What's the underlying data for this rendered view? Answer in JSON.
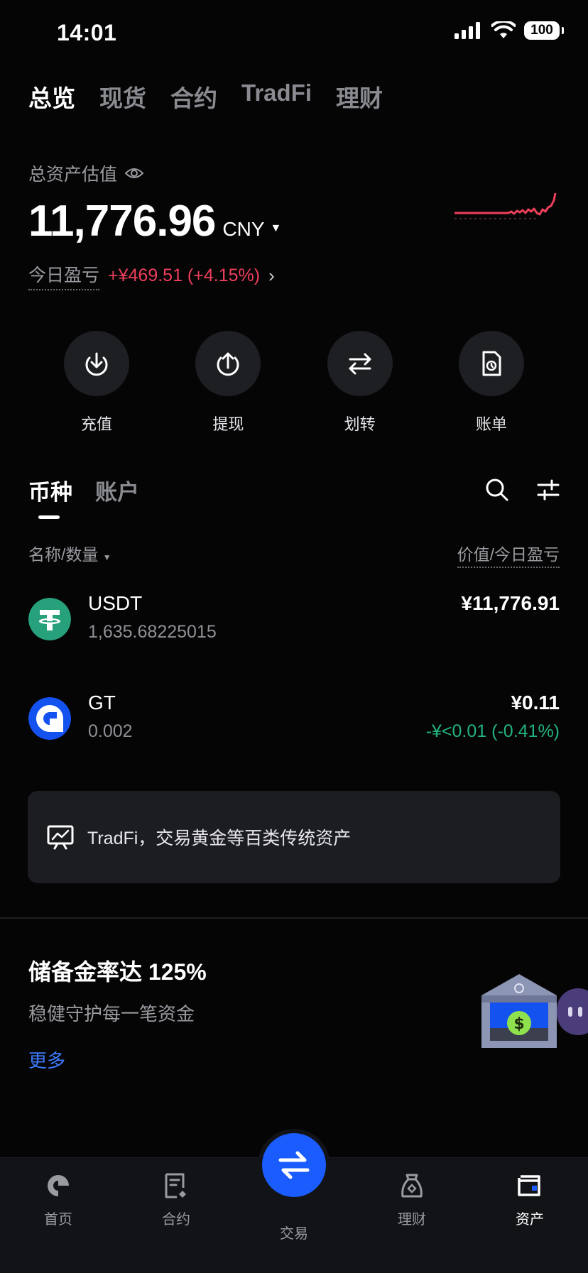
{
  "status": {
    "time": "14:01",
    "battery": "100"
  },
  "top_tabs": [
    {
      "label": "总览",
      "active": true
    },
    {
      "label": "现货",
      "active": false
    },
    {
      "label": "合约",
      "active": false
    },
    {
      "label": "TradFi",
      "active": false
    },
    {
      "label": "理财",
      "active": false
    }
  ],
  "summary": {
    "label": "总资产估值",
    "amount": "11,776.96",
    "currency": "CNY",
    "pnl_label": "今日盈亏",
    "pnl_value": "+¥469.51 (+4.15%)",
    "sparkline_color": "#ee3f5b"
  },
  "actions": [
    {
      "label": "充值",
      "icon": "deposit-icon"
    },
    {
      "label": "提现",
      "icon": "withdraw-icon"
    },
    {
      "label": "划转",
      "icon": "transfer-icon"
    },
    {
      "label": "账单",
      "icon": "bill-icon"
    }
  ],
  "asset_tabs": [
    {
      "label": "币种",
      "active": true
    },
    {
      "label": "账户",
      "active": false
    }
  ],
  "columns": {
    "left": "名称/数量",
    "right": "价值/今日盈亏"
  },
  "assets": [
    {
      "symbol": "USDT",
      "quantity": "1,635.68225015",
      "value": "¥11,776.91",
      "change": "",
      "color": "#26a17b"
    },
    {
      "symbol": "GT",
      "quantity": "0.002",
      "value": "¥0.11",
      "change": "-¥<0.01 (-0.41%)",
      "color": "#1452f0"
    }
  ],
  "banner": {
    "text": "TradFi，交易黄金等百类传统资产",
    "icon": "chart-board-icon"
  },
  "reserve": {
    "title": "储备金率达 125%",
    "subtitle": "稳健守护每一笔资金",
    "more": "更多"
  },
  "bottom_nav": [
    {
      "label": "首页",
      "icon": "home-icon",
      "active": false
    },
    {
      "label": "合约",
      "icon": "futures-icon",
      "active": false
    },
    {
      "label": "交易",
      "icon": "trade-icon",
      "active": false
    },
    {
      "label": "理财",
      "icon": "earn-icon",
      "active": false
    },
    {
      "label": "资产",
      "icon": "wallet-icon",
      "active": true
    }
  ],
  "colors": {
    "positive": "#ee3f5b",
    "negative": "#21b47d",
    "accent": "#1b5cff",
    "link": "#3d7bff"
  }
}
